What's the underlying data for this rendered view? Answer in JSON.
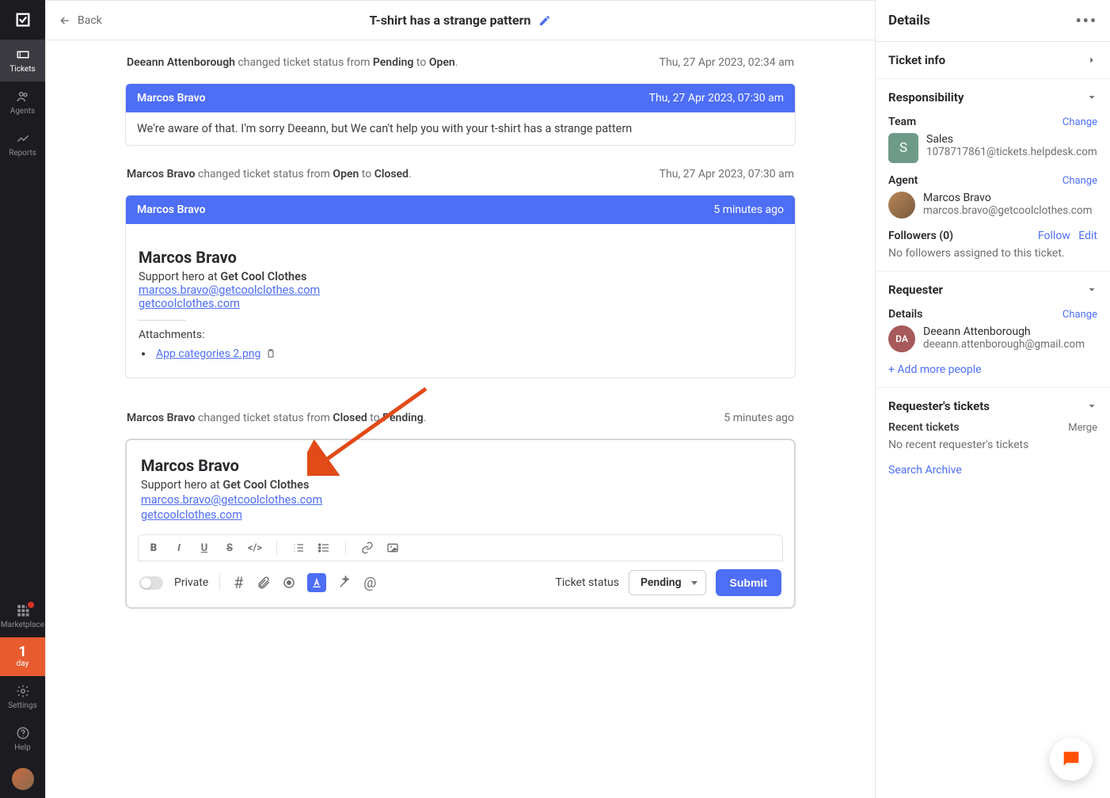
{
  "sidebar": {
    "items": [
      {
        "label": "Tickets"
      },
      {
        "label": "Agents"
      },
      {
        "label": "Reports"
      }
    ],
    "marketplace": "Marketplace",
    "day_num": "1",
    "day_lbl": "day",
    "settings": "Settings",
    "help": "Help"
  },
  "header": {
    "back": "Back",
    "title": "T-shirt has a strange pattern"
  },
  "events": {
    "e1_actor": "Deeann Attenborough",
    "e1_text": " changed ticket status from ",
    "e1_from": "Pending",
    "e1_mid": " to ",
    "e1_to": "Open",
    "e1_time": "Thu, 27 Apr 2023, 02:34 am",
    "m1_name": "Marcos Bravo",
    "m1_time": "Thu, 27 Apr 2023, 07:30 am",
    "m1_body": "We're aware of that. I'm sorry Deeann, but We can't help you with your t-shirt has a strange pattern",
    "e2_actor": "Marcos Bravo",
    "e2_text": " changed ticket status from ",
    "e2_from": "Open",
    "e2_mid": " to ",
    "e2_to": "Closed",
    "e2_time": "Thu, 27 Apr 2023, 07:30 am",
    "m2_name": "Marcos Bravo",
    "m2_time": "5 minutes ago",
    "sig_name": "Marcos Bravo",
    "sig_role_pre": "Support hero at ",
    "sig_company": "Get Cool Clothes",
    "sig_email": "marcos.bravo@getcoolclothes.com",
    "sig_site": "getcoolclothes.com",
    "attach_head": "Attachments:",
    "attach_name": "App categories 2.png",
    "e3_actor": "Marcos Bravo",
    "e3_text": " changed ticket status from ",
    "e3_from": "Closed",
    "e3_mid": " to ",
    "e3_to": "Pending",
    "e3_time": "5 minutes ago"
  },
  "compose": {
    "sig_name": "Marcos Bravo",
    "sig_role_pre": "Support hero at ",
    "sig_company": "Get Cool Clothes",
    "sig_email": "marcos.bravo@getcoolclothes.com",
    "sig_site": "getcoolclothes.com",
    "private": "Private",
    "ticket_status": "Ticket status",
    "status": "Pending",
    "submit": "Submit"
  },
  "details": {
    "title": "Details",
    "ticket_info": "Ticket info",
    "responsibility": "Responsibility",
    "team": "Team",
    "change": "Change",
    "team_name": "Sales",
    "team_email": "1078717861@tickets.helpdesk.com",
    "team_avatar": "S",
    "agent": "Agent",
    "agent_name": "Marcos Bravo",
    "agent_email": "marcos.bravo@getcoolclothes.com",
    "followers": "Followers (0)",
    "follow": "Follow",
    "edit": "Edit",
    "no_followers": "No followers assigned to this ticket.",
    "requester": "Requester",
    "req_details": "Details",
    "req_name": "Deeann Attenborough",
    "req_email": "deeann.attenborough@gmail.com",
    "req_avatar": "DA",
    "add_more": "+ Add more people",
    "req_tickets": "Requester's tickets",
    "recent": "Recent tickets",
    "merge": "Merge",
    "no_recent": "No recent requester's tickets",
    "search_archive": "Search Archive"
  }
}
